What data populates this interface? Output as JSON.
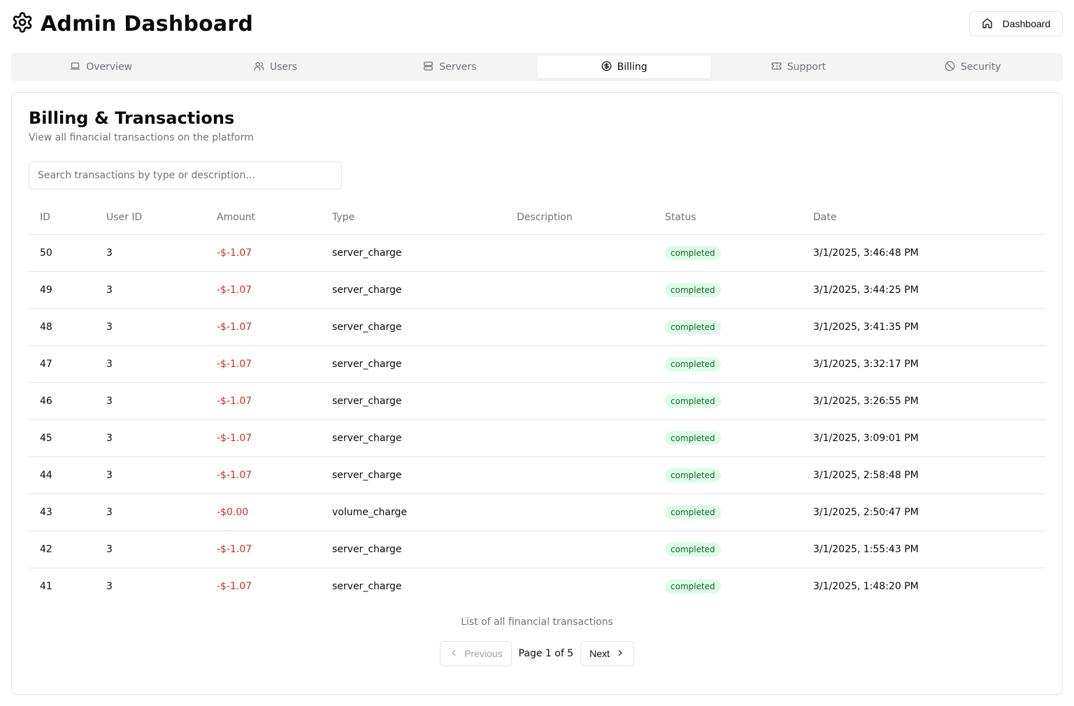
{
  "header": {
    "title": "Admin Dashboard",
    "icon": "gear-icon",
    "dashboard_button": "Dashboard"
  },
  "tabs": [
    {
      "label": "Overview",
      "icon": "laptop-icon",
      "active": false
    },
    {
      "label": "Users",
      "icon": "users-icon",
      "active": false
    },
    {
      "label": "Servers",
      "icon": "server-icon",
      "active": false
    },
    {
      "label": "Billing",
      "icon": "dollar-circle-icon",
      "active": true
    },
    {
      "label": "Support",
      "icon": "ticket-icon",
      "active": false
    },
    {
      "label": "Security",
      "icon": "ban-icon",
      "active": false
    }
  ],
  "billing": {
    "title": "Billing & Transactions",
    "description": "View all financial transactions on the platform",
    "search_placeholder": "Search transactions by type or description...",
    "columns": [
      "ID",
      "User ID",
      "Amount",
      "Type",
      "Description",
      "Status",
      "Date"
    ],
    "rows": [
      {
        "id": "50",
        "user_id": "3",
        "amount": "-$-1.07",
        "type": "server_charge",
        "description": "",
        "status": "completed",
        "date": "3/1/2025, 3:46:48 PM"
      },
      {
        "id": "49",
        "user_id": "3",
        "amount": "-$-1.07",
        "type": "server_charge",
        "description": "",
        "status": "completed",
        "date": "3/1/2025, 3:44:25 PM"
      },
      {
        "id": "48",
        "user_id": "3",
        "amount": "-$-1.07",
        "type": "server_charge",
        "description": "",
        "status": "completed",
        "date": "3/1/2025, 3:41:35 PM"
      },
      {
        "id": "47",
        "user_id": "3",
        "amount": "-$-1.07",
        "type": "server_charge",
        "description": "",
        "status": "completed",
        "date": "3/1/2025, 3:32:17 PM"
      },
      {
        "id": "46",
        "user_id": "3",
        "amount": "-$-1.07",
        "type": "server_charge",
        "description": "",
        "status": "completed",
        "date": "3/1/2025, 3:26:55 PM"
      },
      {
        "id": "45",
        "user_id": "3",
        "amount": "-$-1.07",
        "type": "server_charge",
        "description": "",
        "status": "completed",
        "date": "3/1/2025, 3:09:01 PM"
      },
      {
        "id": "44",
        "user_id": "3",
        "amount": "-$-1.07",
        "type": "server_charge",
        "description": "",
        "status": "completed",
        "date": "3/1/2025, 2:58:48 PM"
      },
      {
        "id": "43",
        "user_id": "3",
        "amount": "-$0.00",
        "type": "volume_charge",
        "description": "",
        "status": "completed",
        "date": "3/1/2025, 2:50:47 PM"
      },
      {
        "id": "42",
        "user_id": "3",
        "amount": "-$-1.07",
        "type": "server_charge",
        "description": "",
        "status": "completed",
        "date": "3/1/2025, 1:55:43 PM"
      },
      {
        "id": "41",
        "user_id": "3",
        "amount": "-$-1.07",
        "type": "server_charge",
        "description": "",
        "status": "completed",
        "date": "3/1/2025, 1:48:20 PM"
      }
    ],
    "caption": "List of all financial transactions"
  },
  "pagination": {
    "previous": "Previous",
    "page_info": "Page 1 of 5",
    "next": "Next"
  },
  "colors": {
    "amount_negative": "#dc2626",
    "status_completed_bg": "#dcfce7",
    "status_completed_text": "#166534",
    "muted": "#71717a",
    "border": "#e4e4e7"
  }
}
